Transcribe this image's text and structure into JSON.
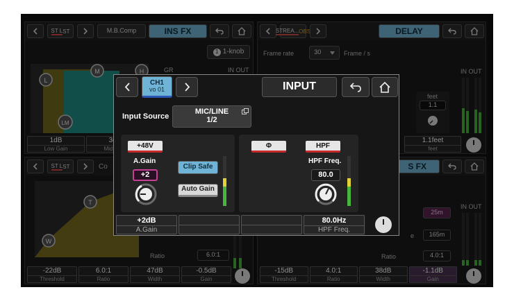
{
  "background_panels": {
    "top_left": {
      "channel_line1": "ST L",
      "channel_line2": "ST",
      "plugin_name": "M.B.Comp",
      "mode_label": "INS FX",
      "one_knob_label": "1-knob",
      "one_knob_num": "1",
      "gr_label": "GR",
      "inout_label": "IN OUT",
      "nodes": [
        "L",
        "M",
        "H",
        "LM"
      ],
      "params": [
        {
          "value": "1dB",
          "name": "Low Gain"
        },
        {
          "value": "3dB",
          "name": "Mid Gain"
        }
      ]
    },
    "top_right": {
      "channel_line1": "STREA...",
      "channel_line2": "OBS",
      "mode_label": "DELAY",
      "frame_rate_label": "Frame rate",
      "frame_rate_value": "30",
      "frame_rate_unit": "Frame / s",
      "feet_label": "feet",
      "feet_value": "1.1",
      "inout_label": "IN OUT",
      "params": [
        {
          "value": "1.1feet",
          "name": "feet"
        }
      ]
    },
    "bottom_left": {
      "channel_line1": "ST L",
      "channel_line2": "ST",
      "plugin_name_partial": "Co",
      "nodes": [
        "T",
        "W"
      ],
      "ratio_label": "Ratio",
      "ratio_value": "6.0:1",
      "params": [
        {
          "value": "-22dB",
          "name": "Threshold"
        },
        {
          "value": "6.0:1",
          "name": "Ratio"
        },
        {
          "value": "47dB",
          "name": "Width"
        },
        {
          "value": "-0.5dB",
          "name": "Gain"
        }
      ]
    },
    "bottom_right": {
      "mode_label_partial": "S FX",
      "inout_label": "IN OUT",
      "value_a": "25m",
      "value_b": "165m",
      "value_b_prefix": "e",
      "ratio_label": "Ratio",
      "ratio_value": "4.0:1",
      "params": [
        {
          "value": "-15dB",
          "name": "Threshold"
        },
        {
          "value": "4.0:1",
          "name": "Ratio"
        },
        {
          "value": "38dB",
          "name": "Width"
        },
        {
          "value": "-1.1dB",
          "name": "Gain"
        }
      ]
    }
  },
  "input_popup": {
    "channel_line1": "CH1",
    "channel_line2": "vo 01",
    "title": "INPUT",
    "input_source_label": "Input Source",
    "input_source_line1": "MIC/LINE",
    "input_source_line2": "1/2",
    "phantom_label": "+48V",
    "again_label": "A.Gain",
    "again_value": "+2",
    "clip_safe_label": "Clip Safe",
    "auto_gain_label": "Auto Gain",
    "phase_label": "Φ",
    "hpf_label": "HPF",
    "hpf_freq_label": "HPF Freq.",
    "hpf_freq_value": "80.0",
    "params": [
      {
        "value": "+2dB",
        "name": "A.Gain"
      },
      {
        "value": "",
        "name": ""
      },
      {
        "value": "",
        "name": ""
      },
      {
        "value": "80.0Hz",
        "name": "HPF Freq."
      }
    ],
    "meter_levels": {
      "again": 0.55,
      "hpf": 0.55
    }
  },
  "colors": {
    "accent_blue": "#6fb4d6",
    "meter_green": "#49b53f",
    "meter_yellow": "#e2d23a",
    "channel_red": "#d34a4a",
    "eq_teal": "#1f8f86",
    "curve_yellow": "#8a7a1e"
  }
}
